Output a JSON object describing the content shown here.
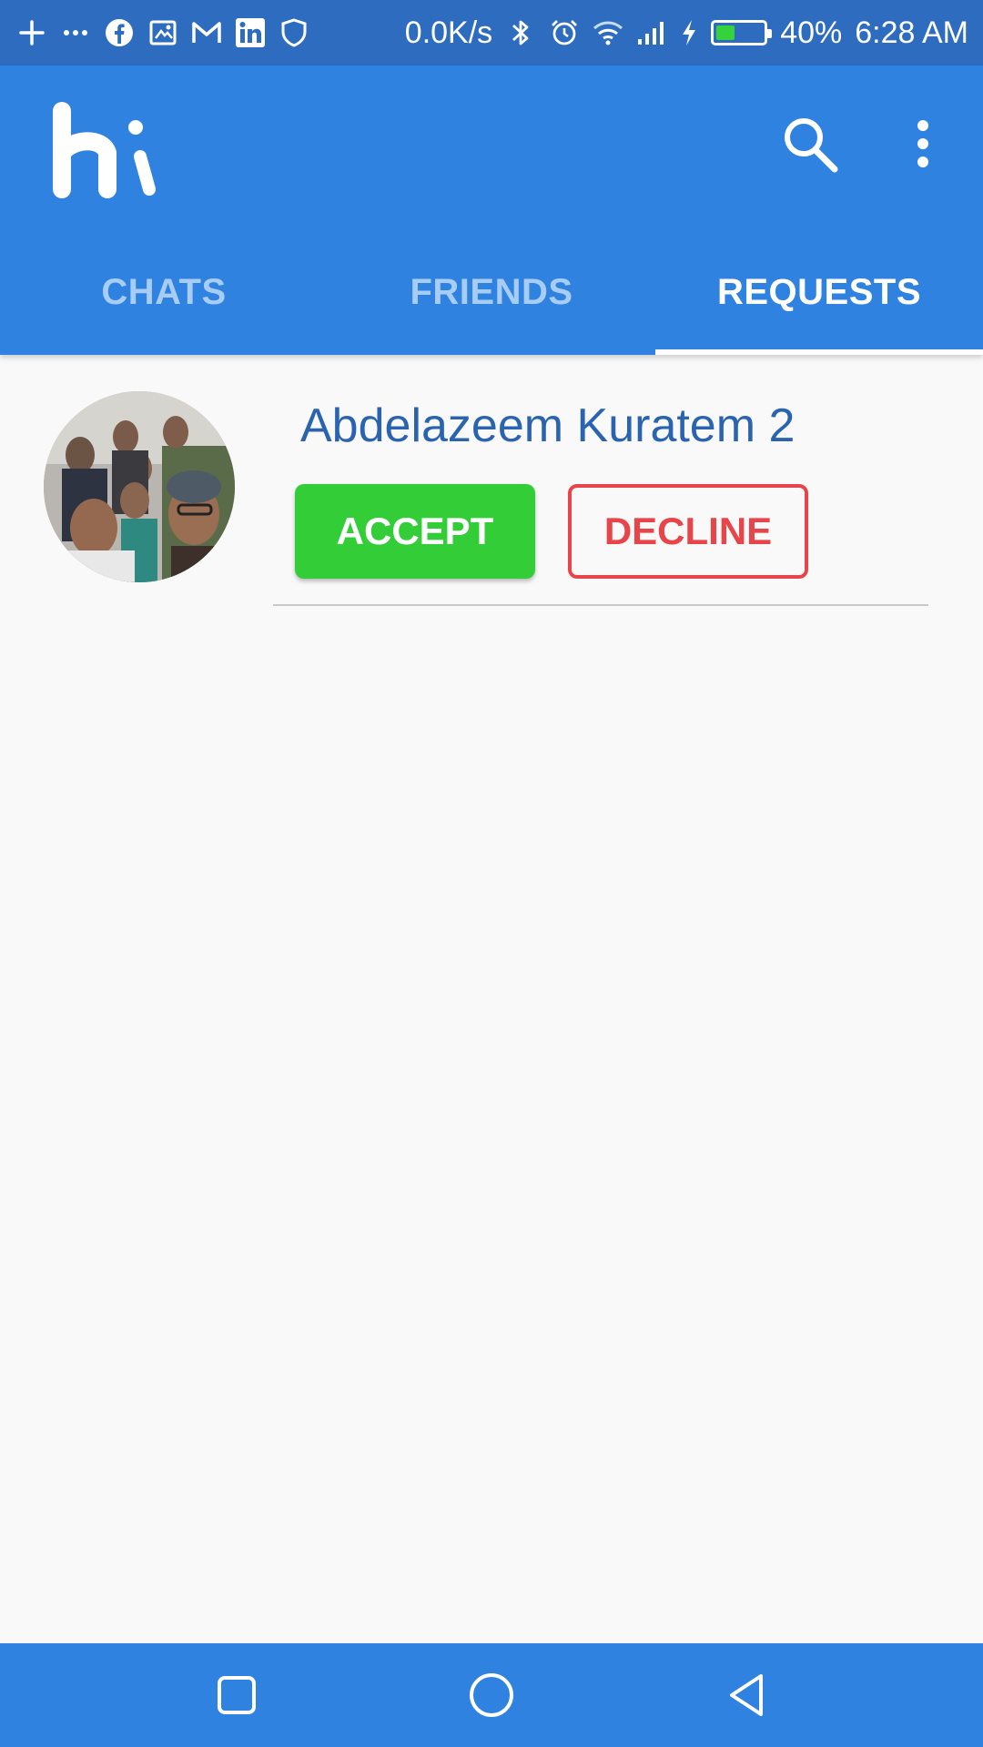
{
  "status_bar": {
    "net_speed": "0.0K/s",
    "battery_percent": "40%",
    "battery_level": 0.4,
    "time": "6:28 AM",
    "left_icons": [
      "plus-icon",
      "more-dots-icon",
      "facebook-icon",
      "cast-icon",
      "gmail-icon",
      "linkedin-icon",
      "shield-icon"
    ],
    "right_icons": [
      "bluetooth-icon",
      "alarm-icon",
      "wifi-icon",
      "signal-icon",
      "charging-icon",
      "battery-icon"
    ]
  },
  "app_bar": {
    "logo_icon": "hi-logo",
    "actions": [
      "search-icon",
      "more-vert-icon"
    ],
    "color": "#2f82e0"
  },
  "tabs": [
    {
      "label": "CHATS",
      "active": false
    },
    {
      "label": "FRIENDS",
      "active": false
    },
    {
      "label": "REQUESTS",
      "active": true
    }
  ],
  "requests": [
    {
      "name": "Abdelazeem Kuratem 2",
      "accept_label": "ACCEPT",
      "decline_label": "DECLINE"
    }
  ],
  "colors": {
    "primary": "#2f82e0",
    "status_bar": "#2e6cc0",
    "accept": "#32cd37",
    "decline": "#e8454a",
    "name_text": "#2a64b0"
  },
  "nav_bar": {
    "buttons": [
      "recents-square-icon",
      "home-circle-icon",
      "back-triangle-icon"
    ]
  }
}
